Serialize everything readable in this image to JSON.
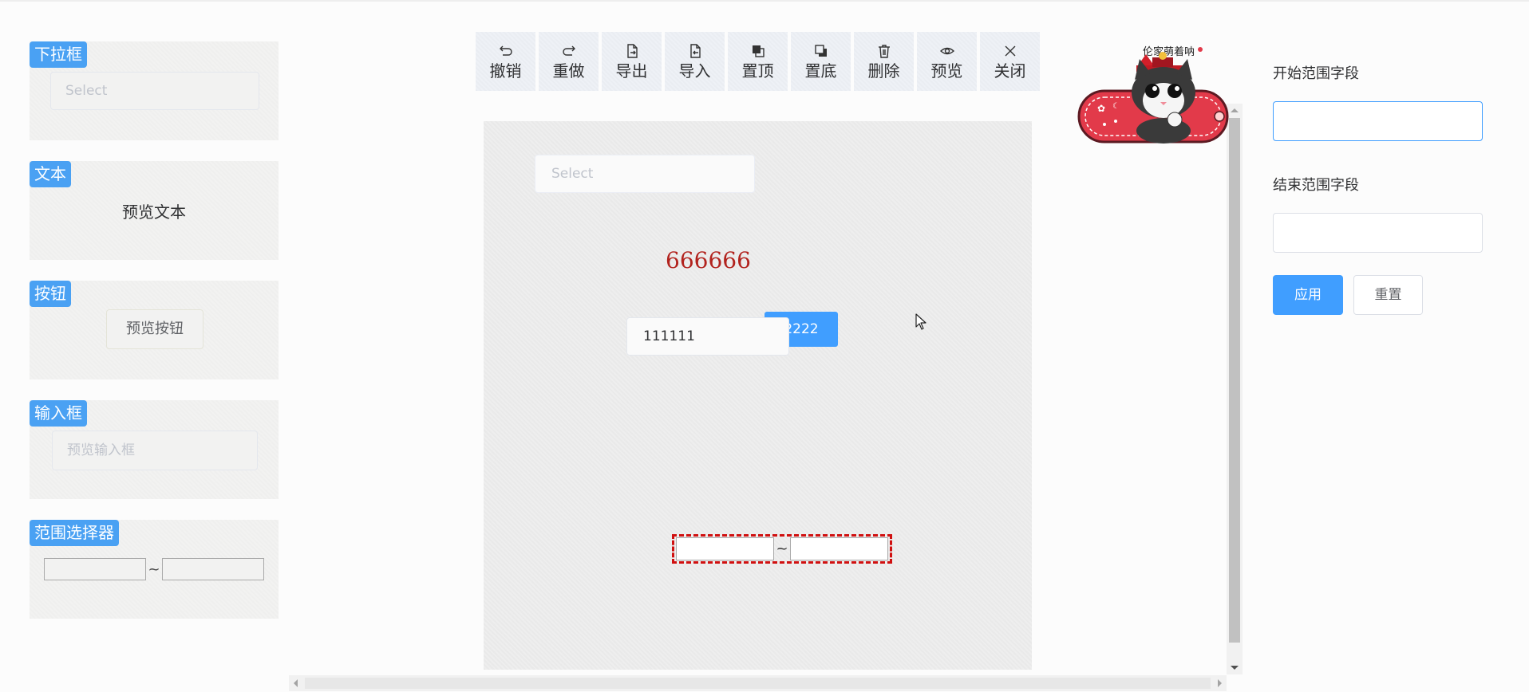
{
  "palette": {
    "select": {
      "tag": "下拉框",
      "placeholder": "Select"
    },
    "text": {
      "tag": "文本",
      "preview": "预览文本"
    },
    "button": {
      "tag": "按钮",
      "preview": "预览按钮"
    },
    "input": {
      "tag": "输入框",
      "placeholder": "预览输入框"
    },
    "range": {
      "tag": "范围选择器",
      "separator": "~"
    }
  },
  "toolbar": {
    "items": [
      {
        "label": "撤销",
        "icon": "undo-icon"
      },
      {
        "label": "重做",
        "icon": "redo-icon"
      },
      {
        "label": "导出",
        "icon": "export-icon"
      },
      {
        "label": "导入",
        "icon": "import-icon"
      },
      {
        "label": "置顶",
        "icon": "bring-to-front-icon"
      },
      {
        "label": "置底",
        "icon": "send-to-back-icon"
      },
      {
        "label": "删除",
        "icon": "trash-icon"
      },
      {
        "label": "预览",
        "icon": "eye-icon"
      },
      {
        "label": "关闭",
        "icon": "close-icon"
      }
    ]
  },
  "canvas": {
    "select_placeholder": "Select",
    "text": "666666",
    "button_label": "2222",
    "input_value": "111111",
    "range_separator": "~"
  },
  "mascot": {
    "caption": "伦家萌着呐"
  },
  "properties": {
    "start_label": "开始范围字段",
    "start_value": "",
    "end_label": "结束范围字段",
    "end_value": "",
    "apply_label": "应用",
    "reset_label": "重置"
  },
  "colors": {
    "accent": "#409eff",
    "tag": "#4aa1f3",
    "canvas_text": "#b2231e",
    "selection_outline": "#d01010"
  }
}
